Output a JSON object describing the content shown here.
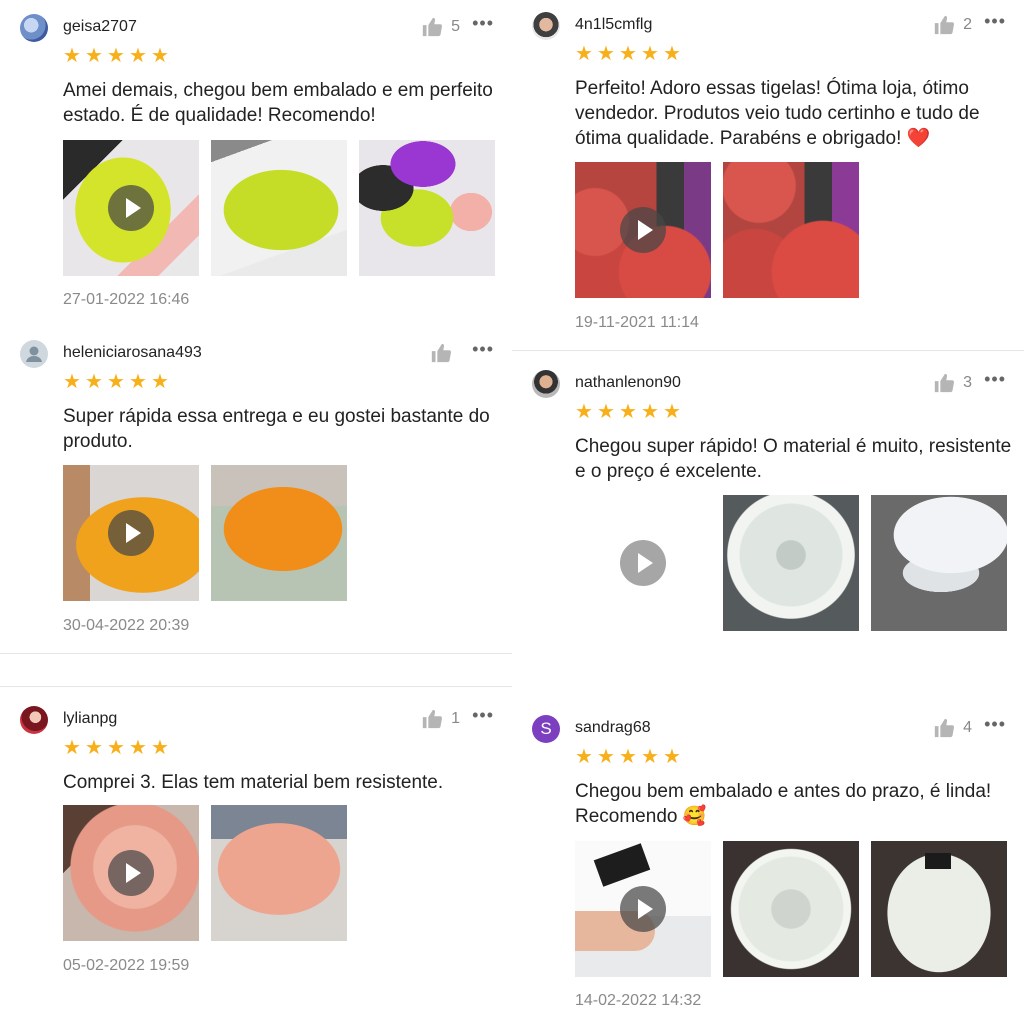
{
  "reviews": [
    {
      "user": "geisa2707",
      "likes": "5",
      "stars": 5,
      "text": "Amei demais, chegou bem embalado e em perfeito estado. É de qualidade! Recomendo!",
      "date": "27-01-2022 16:46",
      "avatar_icon": "user-photo-avatar",
      "images": [
        "lime-bowl-video-thumbnail",
        "lime-bowl-photo",
        "colored-bowls-photo"
      ]
    },
    {
      "user": "heleniciarosana493",
      "likes": "",
      "stars": 5,
      "text": "Super rápida essa entrega e eu gostei bastante do produto.",
      "date": "30-04-2022 20:39",
      "avatar_icon": "default-user-avatar",
      "images": [
        "orange-bowl-video-thumbnail",
        "orange-bowl-photo"
      ]
    },
    {
      "user": "lylianpg",
      "likes": "1",
      "stars": 5,
      "text": "Comprei 3. Elas tem material bem resistente.",
      "date": "05-02-2022 19:59",
      "avatar_icon": "user-photo-avatar",
      "images": [
        "pink-bowl-video-thumbnail",
        "pink-bowl-photo"
      ]
    },
    {
      "user": "4n1l5cmflg",
      "likes": "2",
      "stars": 5,
      "text": "Perfeito! Adoro essas tigelas! Ótima loja, ótimo vendedor. Produtos veio tudo certinho e tudo de ótima qualidade. Parabéns e obrigado! ❤️",
      "date": "19-11-2021 11:14",
      "avatar_icon": "user-photo-avatar",
      "images": [
        "red-bowls-video-thumbnail",
        "red-bowls-photo"
      ]
    },
    {
      "user": "nathanlenon90",
      "likes": "3",
      "stars": 5,
      "text": "Chegou super rápido! O material é muito, resistente e o preço é excelente.",
      "date": "",
      "avatar_icon": "user-photo-avatar",
      "images": [
        "white-video-thumbnail",
        "white-bowl-inside-photo",
        "white-bowl-side-photo"
      ]
    },
    {
      "user": "sandrag68",
      "likes": "4",
      "stars": 5,
      "text": "Chegou bem embalado e antes do prazo, é linda! Recomendo 🥰",
      "date": "14-02-2022 14:32",
      "avatar_letter": "S",
      "avatar_color": "#7b3fbf",
      "images": [
        "white-bowl-video-thumbnail",
        "white-bowl-top-photo",
        "white-bowl-bottom-photo"
      ]
    }
  ],
  "colors": {
    "star": "#f8b01a",
    "meta_text": "#8a8a8a",
    "like_icon": "#b5b5b5"
  }
}
